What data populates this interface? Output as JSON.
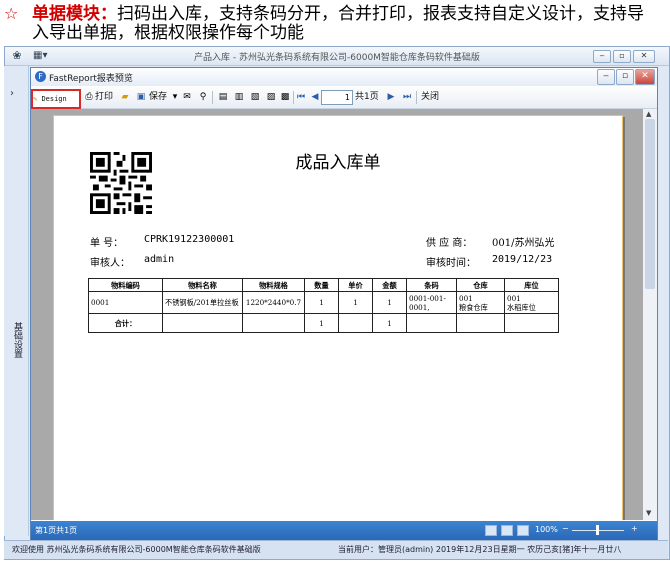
{
  "heading": {
    "module_name": "单据模块：",
    "line1_rest": "扫码出入库，支持条码分开，合并打印，报表支持自定义设计，支持导",
    "line2": "入导出单据，根据权限操作每个功能"
  },
  "outer_window": {
    "title": "产品入库 - 苏州弘光条码系统有限公司-6000M智能仓库条码软件基础版",
    "rail_label": "基础设置"
  },
  "inner_window": {
    "title": "FastReport报表预览"
  },
  "toolbar": {
    "design": "Design",
    "print": "打印",
    "save": "保存",
    "page_value": "1",
    "page_total": "共1页",
    "close": "关闭"
  },
  "report": {
    "title": "成品入库单",
    "no_label": "单  号：",
    "no_value": "CPRK19122300001",
    "auditor_label": "审核人：",
    "auditor_value": "admin",
    "supplier_label": "供 应 商：",
    "supplier_value": "001/苏州弘光",
    "audit_time_label": "审核时间：",
    "audit_time_value": "2019/12/23",
    "columns": [
      "物料编码",
      "物料名称",
      "物料规格",
      "数量",
      "单价",
      "金额",
      "条码",
      "仓库",
      "库位"
    ],
    "rows": [
      [
        "0001",
        "不锈钢板/201单拉丝板",
        "1220*2440*0.7",
        "1",
        "1",
        "1",
        "0001-001-0001,",
        "001\n粮食仓库",
        "001\n水稻库位"
      ]
    ],
    "total_label": "合计：",
    "total_quantity": "1",
    "total_amount": "1"
  },
  "status": {
    "pages": "第1页共1页",
    "zoom": "100%",
    "zoom_minus": "−",
    "zoom_plus": "+"
  },
  "bottom_status": {
    "left": "欢迎使用 苏州弘光条码系统有限公司-6000M智能仓库条码软件基础版",
    "right": "当前用户：管理员(admin)   2019年12月23日星期一  农历己亥[猪]年十一月廿八"
  }
}
